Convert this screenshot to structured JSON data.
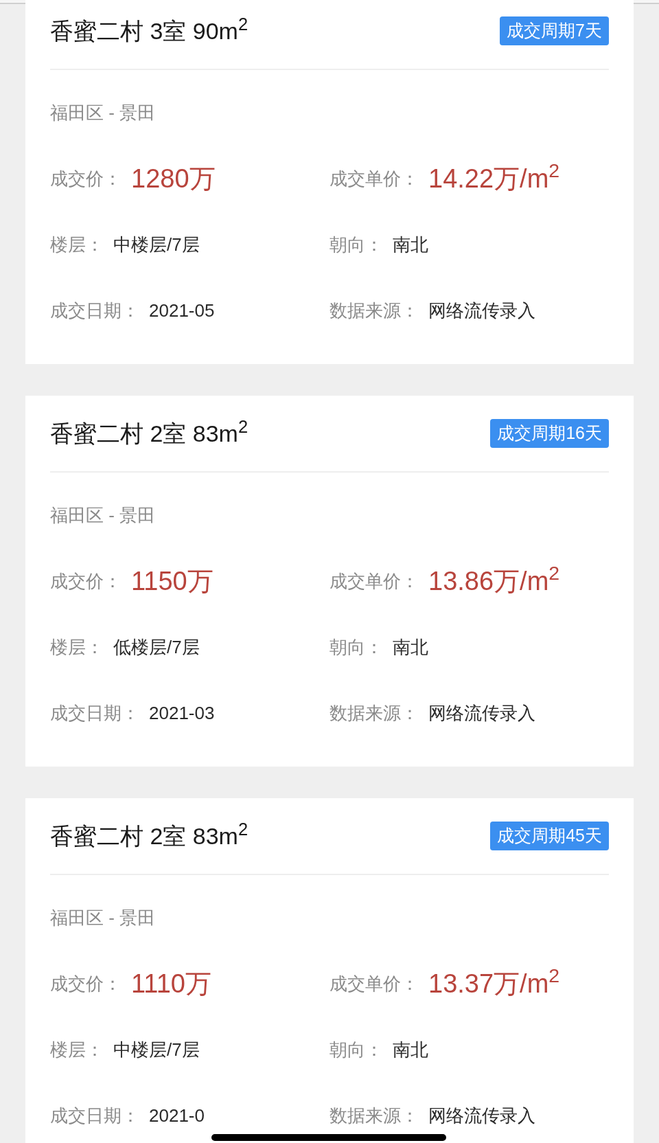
{
  "listings": [
    {
      "title": "香蜜二村 3室 90m$^{2}$",
      "badge": "成交周期7天",
      "district": "福田区 - 景田",
      "fields": [
        {
          "kind": "price",
          "label": "成交价：",
          "value": "1280万"
        },
        {
          "kind": "price",
          "label": "成交单价：",
          "value": "14.22万/m$^{2}$"
        },
        {
          "kind": "plain",
          "label": "楼层：",
          "value": "中楼层/7层"
        },
        {
          "kind": "plain",
          "label": "朝向：",
          "value": "南北"
        },
        {
          "kind": "plain",
          "label": "成交日期：",
          "value": "2021-05"
        },
        {
          "kind": "plain",
          "label": "数据来源：",
          "value": "网络流传录入"
        }
      ]
    },
    {
      "title": "香蜜二村 2室 83m$^{2}$",
      "badge": "成交周期16天",
      "district": "福田区 - 景田",
      "fields": [
        {
          "kind": "price",
          "label": "成交价：",
          "value": "1150万"
        },
        {
          "kind": "price",
          "label": "成交单价：",
          "value": "13.86万/m$^{2}$"
        },
        {
          "kind": "plain",
          "label": "楼层：",
          "value": "低楼层/7层"
        },
        {
          "kind": "plain",
          "label": "朝向：",
          "value": "南北"
        },
        {
          "kind": "plain",
          "label": "成交日期：",
          "value": "2021-03"
        },
        {
          "kind": "plain",
          "label": "数据来源：",
          "value": "网络流传录入"
        }
      ]
    },
    {
      "title": "香蜜二村 2室 83m$^{2}$",
      "badge": "成交周期45天",
      "district": "福田区 - 景田",
      "fields": [
        {
          "kind": "price",
          "label": "成交价：",
          "value": "1110万"
        },
        {
          "kind": "price",
          "label": "成交单价：",
          "value": "13.37万/m$^{2}$"
        },
        {
          "kind": "plain",
          "label": "楼层：",
          "value": "中楼层/7层"
        },
        {
          "kind": "plain",
          "label": "朝向：",
          "value": "南北"
        },
        {
          "kind": "plain",
          "label": "成交日期：",
          "value": "2021-0"
        },
        {
          "kind": "plain",
          "label": "数据来源：",
          "value": "网络流传录入"
        }
      ]
    }
  ]
}
